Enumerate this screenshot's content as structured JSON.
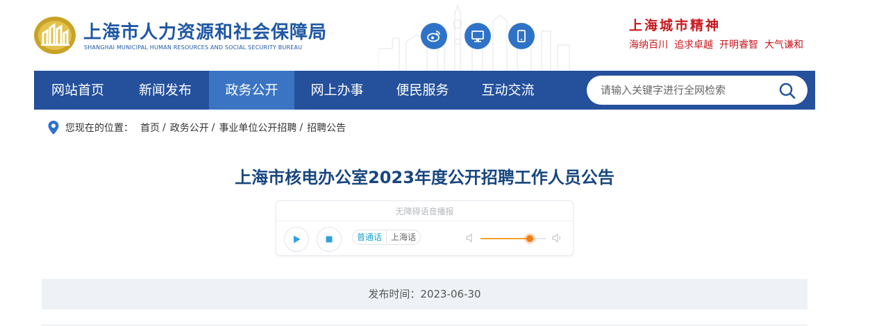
{
  "header": {
    "site_title": "上海市人力资源和社会保障局",
    "site_subtitle": "SHANGHAI MUNICIPAL HUMAN RESOURCES AND SOCIAL SECURITY BUREAU",
    "icons": [
      "weibo-icon",
      "desktop-icon",
      "mobile-icon"
    ],
    "city_spirit": {
      "title": "上海城市精神",
      "words": [
        "海纳百川",
        "追求卓越",
        "开明睿智",
        "大气谦和"
      ]
    }
  },
  "nav": {
    "items": [
      {
        "label": "网站首页",
        "active": false
      },
      {
        "label": "新闻发布",
        "active": false
      },
      {
        "label": "政务公开",
        "active": true
      },
      {
        "label": "网上办事",
        "active": false
      },
      {
        "label": "便民服务",
        "active": false
      },
      {
        "label": "互动交流",
        "active": false
      }
    ],
    "search": {
      "placeholder": "请输入关键字进行全网检索",
      "value": ""
    }
  },
  "breadcrumb": {
    "label": "您现在的位置：",
    "items": [
      "首页",
      "政务公开",
      "事业单位公开招聘",
      "招聘公告"
    ],
    "separator": "/"
  },
  "article": {
    "title": "上海市核电办公室2023年度公开招聘工作人员公告",
    "publish_label": "发布时间：",
    "publish_date": "2023-06-30"
  },
  "player": {
    "title": "无障碍语音播报",
    "languages": [
      "普通话",
      "上海话"
    ],
    "selected_language": "普通话",
    "volume": 0.75
  },
  "colors": {
    "brand_blue": "#24509c",
    "nav_active": "#3b74c2",
    "spirit_red": "#c8161d",
    "title_blue": "#18467f"
  }
}
